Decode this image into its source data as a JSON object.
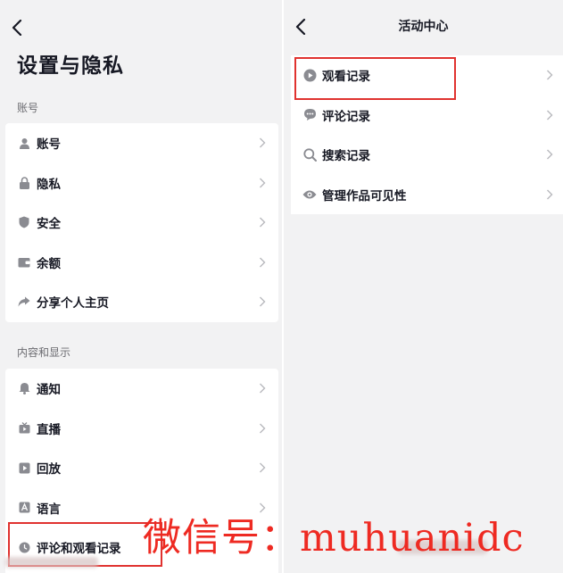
{
  "left": {
    "title": "设置与隐私",
    "sections": [
      {
        "label": "账号",
        "items": [
          {
            "label": "账号",
            "icon": "person-icon"
          },
          {
            "label": "隐私",
            "icon": "lock-icon"
          },
          {
            "label": "安全",
            "icon": "shield-icon"
          },
          {
            "label": "余额",
            "icon": "wallet-icon"
          },
          {
            "label": "分享个人主页",
            "icon": "share-arrow-icon"
          }
        ]
      },
      {
        "label": "内容和显示",
        "items": [
          {
            "label": "通知",
            "icon": "bell-icon"
          },
          {
            "label": "直播",
            "icon": "tv-icon"
          },
          {
            "label": "回放",
            "icon": "play-box-icon"
          },
          {
            "label": "语言",
            "icon": "language-a-icon"
          },
          {
            "label": "评论和观看记录",
            "icon": "clock-icon"
          }
        ]
      }
    ]
  },
  "right": {
    "title": "活动中心",
    "items": [
      {
        "label": "观看记录",
        "icon": "play-circle-icon"
      },
      {
        "label": "评论记录",
        "icon": "comment-icon"
      },
      {
        "label": "搜索记录",
        "icon": "search-icon"
      },
      {
        "label": "管理作品可见性",
        "icon": "eye-icon"
      }
    ]
  },
  "watermark": "微信号：muhuanidc",
  "colors": {
    "background": "#f2f2f3",
    "card": "#ffffff",
    "text": "#161823",
    "icon": "#8a8b91",
    "highlight": "#e0322f",
    "watermark": "#ee2a22"
  }
}
